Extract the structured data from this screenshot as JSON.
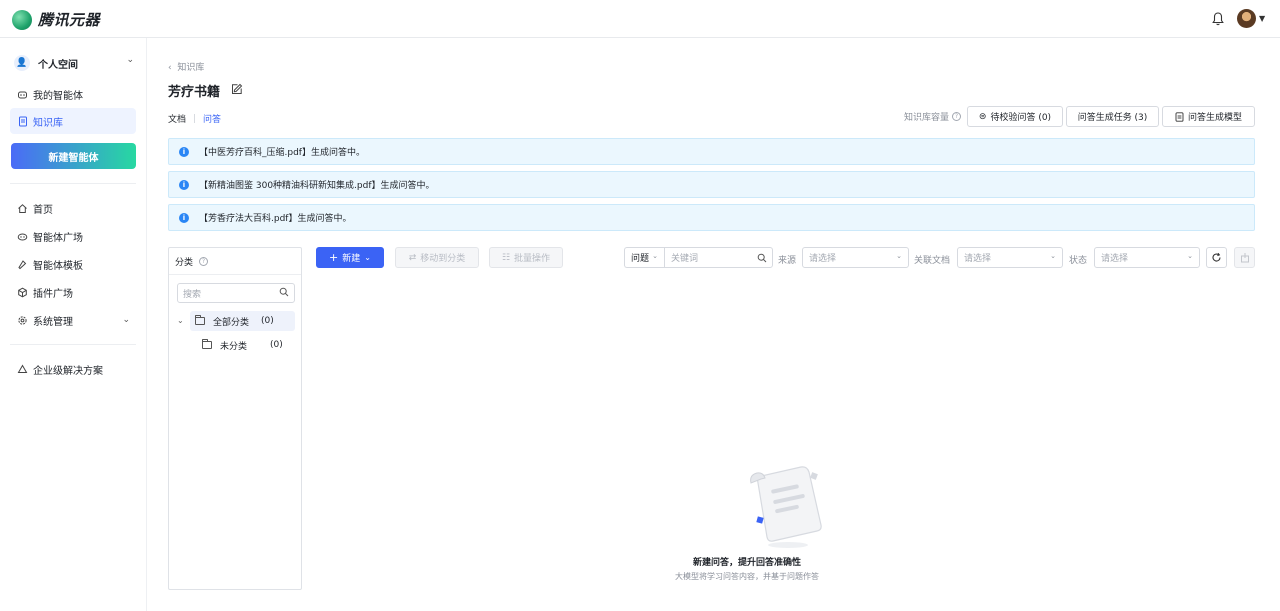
{
  "app": {
    "name": "腾讯元器"
  },
  "sidebar": {
    "space": {
      "label": "个人空间"
    },
    "items": [
      {
        "label": "我的智能体",
        "icon": "robot-icon"
      },
      {
        "label": "知识库",
        "icon": "document-icon"
      }
    ],
    "new_agent": "新建智能体",
    "nav": [
      {
        "label": "首页",
        "icon": "home-icon"
      },
      {
        "label": "智能体广场",
        "icon": "plaza-icon"
      },
      {
        "label": "智能体模板",
        "icon": "template-icon"
      },
      {
        "label": "插件广场",
        "icon": "plugin-icon"
      },
      {
        "label": "系统管理",
        "icon": "settings-icon"
      }
    ],
    "enterprise": {
      "label": "企业级解决方案",
      "icon": "recycle-icon"
    }
  },
  "breadcrumb": "知识库",
  "page_title": "芳疗书籍",
  "tabs": [
    {
      "label": "文档",
      "active": false
    },
    {
      "label": "问答",
      "active": true
    }
  ],
  "header": {
    "capacity_label": "知识库容量",
    "btn_pending": "待校验问答 (0)",
    "btn_tasks": "问答生成任务 (3)",
    "btn_model": "问答生成模型"
  },
  "alerts": [
    "【中医芳疗百科_压缩.pdf】生成问答中。",
    "【新精油图鉴 300种精油科研新知集成.pdf】生成问答中。",
    "【芳香疗法大百科.pdf】生成问答中。"
  ],
  "category": {
    "title": "分类",
    "search_placeholder": "搜索",
    "tree": [
      {
        "label": "全部分类",
        "count": "(0)"
      },
      {
        "label": "未分类",
        "count": "(0)"
      }
    ]
  },
  "toolbar": {
    "new": "新建",
    "move": "移动到分类",
    "batch": "批量操作",
    "field_select": "问题",
    "keyword_placeholder": "关键词",
    "source_label": "来源",
    "source_placeholder": "请选择",
    "doc_label": "关联文档",
    "doc_placeholder": "请选择",
    "status_label": "状态",
    "status_placeholder": "请选择"
  },
  "empty": {
    "title": "新建问答，提升回答准确性",
    "subtitle": "大模型将学习问答内容，并基于问题作答"
  },
  "colors": {
    "primary": "#3b63f5",
    "alert_bg": "#ebf7fe"
  }
}
